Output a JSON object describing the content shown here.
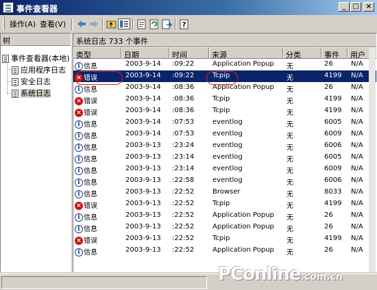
{
  "window": {
    "title": "事件查看器"
  },
  "menu": [
    {
      "label": "操作(A)"
    },
    {
      "label": "查看(V)"
    }
  ],
  "toolbar_icons": [
    "back-arrow-icon",
    "forward-arrow-icon",
    "up-folder-icon",
    "show-hide-tree-icon",
    "properties-icon",
    "refresh-icon",
    "export-list-icon",
    "help-icon"
  ],
  "tree": {
    "header": "树",
    "root": "事件查看器(本地)",
    "items": [
      {
        "label": "应用程序日志"
      },
      {
        "label": "安全日志"
      },
      {
        "label": "系统日志"
      }
    ]
  },
  "main": {
    "header": "系统日志   733 个事件",
    "columns": [
      "类型",
      "日期",
      "时间",
      "来源",
      "分类",
      "事件",
      "用户"
    ],
    "rows": [
      {
        "type": "信息",
        "icon": "info",
        "date": "2003-9-14",
        "time": ":09:22",
        "source": "Application Popup",
        "category": "无",
        "event": "26",
        "user": "N/A"
      },
      {
        "type": "错误",
        "icon": "error",
        "date": "2003-9-14",
        "time": ":09:22",
        "source": "Tcpip",
        "category": "无",
        "event": "4199",
        "user": "N/A",
        "selected": true
      },
      {
        "type": "信息",
        "icon": "info",
        "date": "2003-9-14",
        "time": ":08:36",
        "source": "Application Popup",
        "category": "无",
        "event": "26",
        "user": "N/A"
      },
      {
        "type": "错误",
        "icon": "error",
        "date": "2003-9-14",
        "time": ":08:36",
        "source": "Tcpip",
        "category": "无",
        "event": "4199",
        "user": "N/A"
      },
      {
        "type": "错误",
        "icon": "error",
        "date": "2003-9-14",
        "time": ":08:36",
        "source": "Tcpip",
        "category": "无",
        "event": "4199",
        "user": "N/A"
      },
      {
        "type": "信息",
        "icon": "info",
        "date": "2003-9-14",
        "time": ":07:53",
        "source": "eventlog",
        "category": "无",
        "event": "6005",
        "user": "N/A"
      },
      {
        "type": "信息",
        "icon": "info",
        "date": "2003-9-14",
        "time": ":07:53",
        "source": "eventlog",
        "category": "无",
        "event": "6009",
        "user": "N/A"
      },
      {
        "type": "信息",
        "icon": "info",
        "date": "2003-9-13",
        "time": ":23:24",
        "source": "eventlog",
        "category": "无",
        "event": "6006",
        "user": "N/A"
      },
      {
        "type": "信息",
        "icon": "info",
        "date": "2003-9-13",
        "time": ":23:14",
        "source": "eventlog",
        "category": "无",
        "event": "6005",
        "user": "N/A"
      },
      {
        "type": "信息",
        "icon": "info",
        "date": "2003-9-13",
        "time": ":23:14",
        "source": "eventlog",
        "category": "无",
        "event": "6009",
        "user": "N/A"
      },
      {
        "type": "信息",
        "icon": "info",
        "date": "2003-9-13",
        "time": ":22:58",
        "source": "eventlog",
        "category": "无",
        "event": "6006",
        "user": "N/A"
      },
      {
        "type": "信息",
        "icon": "info",
        "date": "2003-9-13",
        "time": ":22:52",
        "source": "Browser",
        "category": "无",
        "event": "8033",
        "user": "N/A"
      },
      {
        "type": "错误",
        "icon": "error",
        "date": "2003-9-13",
        "time": ":22:52",
        "source": "Tcpip",
        "category": "无",
        "event": "4199",
        "user": "N/A"
      },
      {
        "type": "信息",
        "icon": "info",
        "date": "2003-9-13",
        "time": ":22:52",
        "source": "Application Popup",
        "category": "无",
        "event": "26",
        "user": "N/A"
      },
      {
        "type": "信息",
        "icon": "info",
        "date": "2003-9-13",
        "time": ":22:52",
        "source": "Application Popup",
        "category": "无",
        "event": "26",
        "user": "N/A"
      },
      {
        "type": "错误",
        "icon": "error",
        "date": "2003-9-13",
        "time": ":22:52",
        "source": "Tcpip",
        "category": "无",
        "event": "4199",
        "user": "N/A"
      },
      {
        "type": "信息",
        "icon": "info",
        "date": "2003-9-13",
        "time": ":22:52",
        "source": "Application Popup",
        "category": "无",
        "event": "26",
        "user": "N/A"
      }
    ]
  },
  "watermark": {
    "brand": "PConline",
    "domain": ".com.cn"
  },
  "colors": {
    "selection": "#0a246a",
    "annotation": "#e02020",
    "error": "#d01010",
    "info": "#1a3d8c"
  }
}
